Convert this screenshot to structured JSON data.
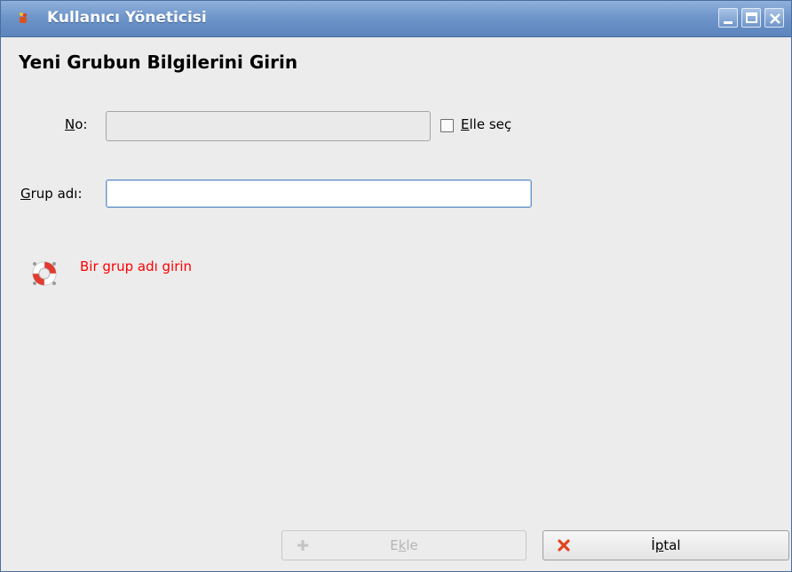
{
  "window": {
    "title": "Kullanıcı Yöneticisi"
  },
  "page": {
    "heading": "Yeni Grubun Bilgilerini Girin"
  },
  "form": {
    "no_label_access": "N",
    "no_label_rest": "o:",
    "no_value": "",
    "manual_access": "E",
    "manual_rest": "lle seç",
    "group_label_access": "G",
    "group_label_rest": "rup adı:",
    "group_value": ""
  },
  "message": {
    "text": "Bir grup adı girin",
    "color": "#ff0000"
  },
  "buttons": {
    "add_pre": "E",
    "add_access": "k",
    "add_post": "le",
    "cancel_pre": "İ",
    "cancel_access": "p",
    "cancel_post": "tal"
  },
  "icons": {
    "app": "app-icon",
    "minimize": "minimize-icon",
    "maximize": "maximize-icon",
    "close": "close-icon",
    "help": "lifebuoy-icon",
    "add": "plus-icon",
    "cancel": "x-icon"
  }
}
